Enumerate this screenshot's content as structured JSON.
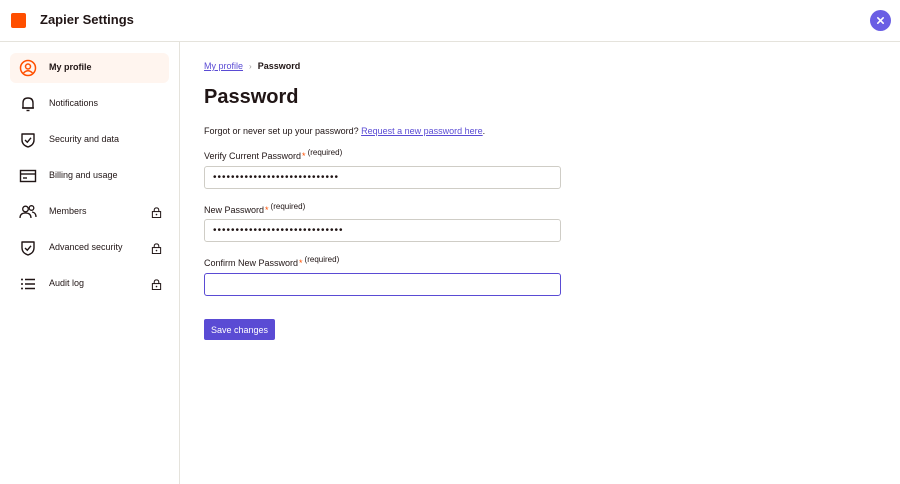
{
  "app": {
    "title": "Zapier Settings"
  },
  "sidebar": {
    "items": [
      {
        "label": "My profile",
        "icon": "profile-icon",
        "active": true,
        "locked": false
      },
      {
        "label": "Notifications",
        "icon": "bell-icon",
        "active": false,
        "locked": false
      },
      {
        "label": "Security and data",
        "icon": "shield-icon",
        "active": false,
        "locked": false
      },
      {
        "label": "Billing and usage",
        "icon": "credit-card-icon",
        "active": false,
        "locked": false
      },
      {
        "label": "Members",
        "icon": "members-icon",
        "active": false,
        "locked": true
      },
      {
        "label": "Advanced security",
        "icon": "shield-icon",
        "active": false,
        "locked": true
      },
      {
        "label": "Audit log",
        "icon": "list-icon",
        "active": false,
        "locked": true
      }
    ]
  },
  "breadcrumb": {
    "parent": "My profile",
    "current": "Password"
  },
  "main": {
    "title": "Password",
    "forgot_text": "Forgot or never set up your password? ",
    "forgot_link": "Request a new password here",
    "forgot_end": "."
  },
  "fields": [
    {
      "label": "Verify Current Password",
      "required_mark": "*",
      "required_text": "(required)",
      "value": "••••••••••••••••••••••••••••"
    },
    {
      "label": "New Password",
      "required_mark": "*",
      "required_text": "(required)",
      "value": "•••••••••••••••••••••••••••••"
    },
    {
      "label": "Confirm New Password",
      "required_mark": "*",
      "required_text": "(required)",
      "value": ""
    }
  ],
  "actions": {
    "save_label": "Save changes"
  },
  "colors": {
    "brand": "#ff4f00",
    "accent": "#5a4bd4",
    "active_bg": "#fff5ef"
  }
}
